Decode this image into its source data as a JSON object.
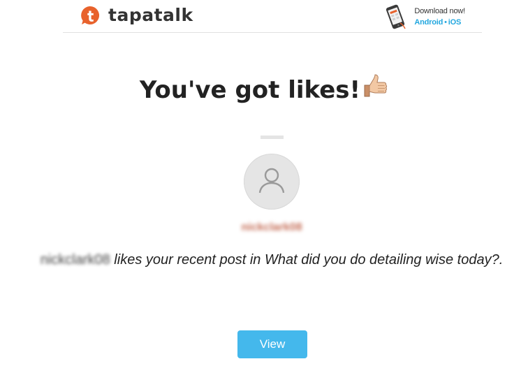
{
  "header": {
    "brand_name": "tapatalk",
    "logo_icon": "tapatalk-logo-icon",
    "download": {
      "title": "Download now!",
      "android_label": "Android",
      "separator": "•",
      "ios_label": "iOS",
      "phone_icon": "smartphone-icon"
    }
  },
  "notification": {
    "headline": "You've got likes!",
    "headline_icon": "thumbs-up-icon",
    "avatar_icon": "user-placeholder-icon",
    "username": "nickclark08",
    "message_user": "nickclark08",
    "message_text": " likes your recent post in What did you do detailing wise today?.",
    "view_button_label": "View"
  },
  "colors": {
    "accent": "#44b8ec",
    "link": "#22a7df",
    "brand": "#e8622c",
    "username": "#c56d56"
  }
}
